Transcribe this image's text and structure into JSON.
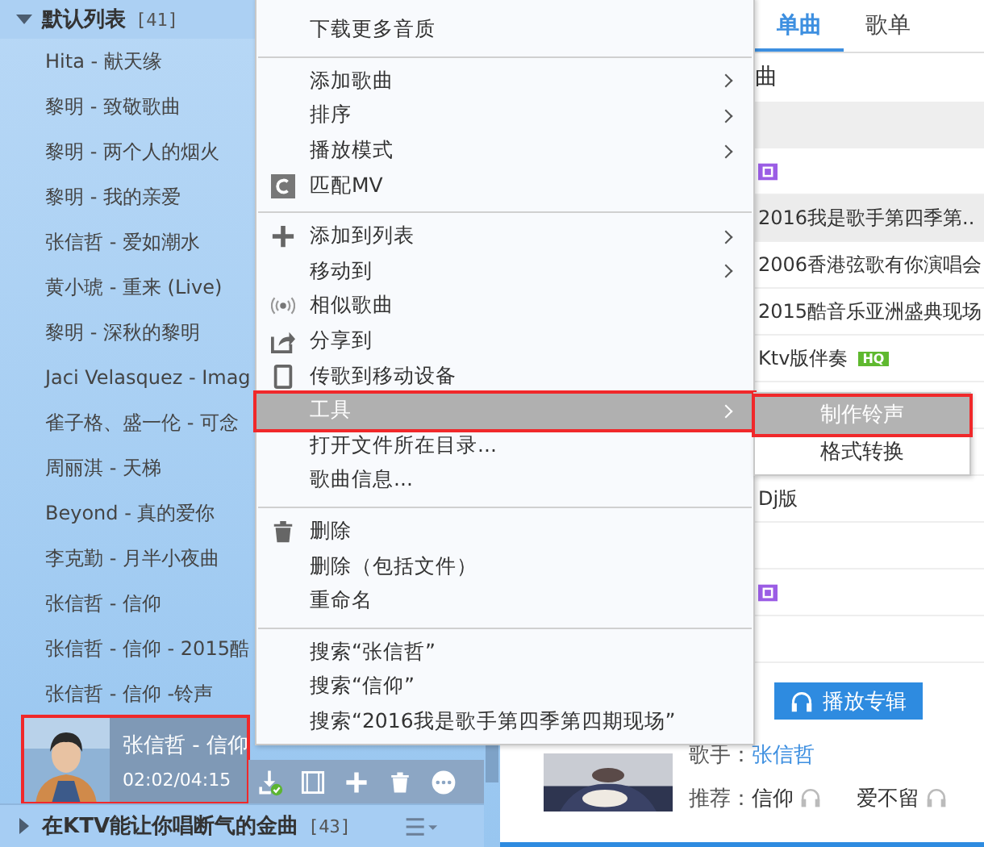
{
  "playlist": {
    "title": "默认列表",
    "count": "[41]",
    "expanded": true,
    "songs": [
      {
        "title": "Hita - 献天缘"
      },
      {
        "title": "黎明 - 致敬歌曲"
      },
      {
        "title": "黎明 - 两个人的烟火"
      },
      {
        "title": "黎明 - 我的亲爱"
      },
      {
        "title": "张信哲 - 爱如潮水"
      },
      {
        "title": "黄小琥 - 重来 (Live)"
      },
      {
        "title": "黎明 - 深秋的黎明"
      },
      {
        "title": "Jaci Velasquez - Imag"
      },
      {
        "title": "雀子格、盛一伦 - 可念"
      },
      {
        "title": "周丽淇 - 天梯"
      },
      {
        "title": "Beyond - 真的爱你"
      },
      {
        "title": "李克勤 - 月半小夜曲"
      },
      {
        "title": "张信哲 - 信仰"
      },
      {
        "title": "张信哲 - 信仰 - 2015酷"
      },
      {
        "title": "张信哲 - 信仰 -铃声"
      }
    ],
    "now_playing": {
      "title": "张信哲 - 信仰",
      "time": "02:02/04:15",
      "highlighted": true
    }
  },
  "other_playlist": {
    "title": "在KTV能让你唱断气的金曲",
    "count": "[43]",
    "expanded": false
  },
  "context_menu": {
    "items": [
      {
        "kind": "item",
        "label": "下载更多音质",
        "submenu": false,
        "selected": false
      },
      {
        "kind": "separator"
      },
      {
        "kind": "item",
        "label": "添加歌曲",
        "submenu": true,
        "selected": false
      },
      {
        "kind": "item",
        "label": "排序",
        "submenu": true,
        "selected": false
      },
      {
        "kind": "item",
        "label": "播放模式",
        "submenu": true,
        "selected": false
      },
      {
        "kind": "item",
        "label": "匹配MV",
        "submenu": false,
        "selected": false
      },
      {
        "kind": "separator"
      },
      {
        "kind": "item",
        "label": "添加到列表",
        "submenu": true,
        "selected": false
      },
      {
        "kind": "item",
        "label": "移动到",
        "submenu": true,
        "selected": false
      },
      {
        "kind": "item",
        "label": "相似歌曲",
        "submenu": false,
        "selected": false
      },
      {
        "kind": "item",
        "label": "分享到",
        "submenu": false,
        "selected": false
      },
      {
        "kind": "item",
        "label": "传歌到移动设备",
        "submenu": false,
        "selected": false
      },
      {
        "kind": "item",
        "label": "工具",
        "submenu": true,
        "selected": true,
        "highlighted": true
      },
      {
        "kind": "item",
        "label": "打开文件所在目录...",
        "submenu": false,
        "selected": false
      },
      {
        "kind": "item",
        "label": "歌曲信息...",
        "submenu": false,
        "selected": false
      },
      {
        "kind": "separator"
      },
      {
        "kind": "item",
        "label": "删除",
        "submenu": false,
        "selected": false
      },
      {
        "kind": "item",
        "label": "删除（包括文件）",
        "submenu": false,
        "selected": false
      },
      {
        "kind": "item",
        "label": "重命名",
        "submenu": false,
        "selected": false
      },
      {
        "kind": "separator"
      },
      {
        "kind": "item",
        "label": "搜索“张信哲”",
        "submenu": false,
        "selected": false
      },
      {
        "kind": "item",
        "label": "搜索“信仰”",
        "submenu": false,
        "selected": false
      },
      {
        "kind": "item",
        "label": "搜索“2016我是歌手第四季第四期现场”",
        "submenu": false,
        "selected": false
      }
    ]
  },
  "submenu": {
    "items": [
      {
        "label": "制作铃声",
        "selected": true,
        "highlighted": true
      },
      {
        "label": "格式转换",
        "selected": false,
        "highlighted": false
      }
    ]
  },
  "search_panel": {
    "tabs": [
      {
        "label": "单曲",
        "selected": true
      },
      {
        "label": "歌单",
        "selected": false
      }
    ],
    "heading": "曲",
    "rows": [
      {
        "kind": "header"
      },
      {
        "kind": "song",
        "badge": {
          "kind": "sq"
        },
        "selected": false
      },
      {
        "kind": "song",
        "text": "2016我是歌手第四季第..",
        "selected": true
      },
      {
        "kind": "song",
        "text": "2006香港弦歌有你演唱会",
        "selected": false
      },
      {
        "kind": "song",
        "text": "2015酷音乐亚洲盛典现场",
        "selected": false
      },
      {
        "kind": "song",
        "text": "Ktv版伴奏",
        "badge": {
          "kind": "hq",
          "text": "HQ"
        },
        "selected": false
      },
      {
        "kind": "song",
        "selected": false
      },
      {
        "kind": "song",
        "selected": false
      },
      {
        "kind": "song",
        "text": "Dj版",
        "selected": false
      },
      {
        "kind": "song",
        "selected": false
      },
      {
        "kind": "song",
        "badge": {
          "kind": "sq"
        },
        "selected": false
      },
      {
        "kind": "song",
        "selected": false
      }
    ],
    "album": {
      "play_button": "播放专辑",
      "singer_label": "歌手：",
      "singer": "张信哲",
      "recommend_label": "推荐：",
      "recommendations": [
        {
          "title": "信仰"
        },
        {
          "title": "爱不留"
        }
      ]
    }
  }
}
